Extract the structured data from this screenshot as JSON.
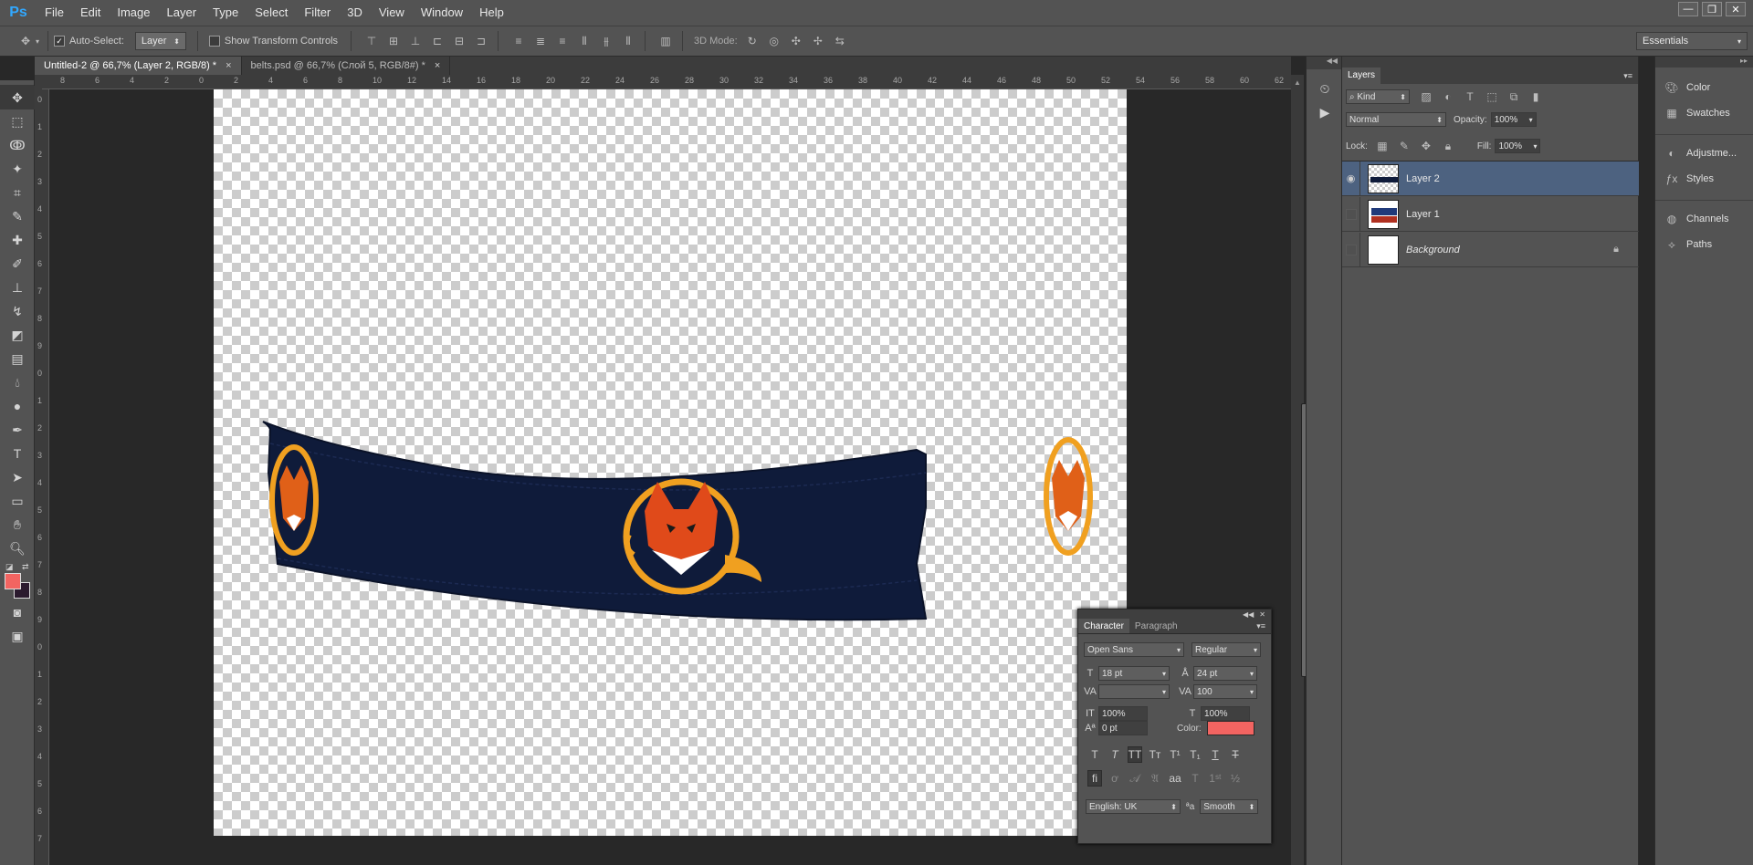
{
  "app": {
    "logo": "Ps"
  },
  "menu": [
    "File",
    "Edit",
    "Image",
    "Layer",
    "Type",
    "Select",
    "Filter",
    "3D",
    "View",
    "Window",
    "Help"
  ],
  "window_controls": [
    "—",
    "❐",
    "✕"
  ],
  "options": {
    "auto_select_label": "Auto-Select:",
    "auto_select_value": "Layer",
    "show_transform_label": "Show Transform Controls",
    "mode3d_label": "3D Mode:",
    "workspace": "Essentials"
  },
  "tabs": [
    {
      "label": "Untitled-2 @ 66,7% (Layer 2, RGB/8) *",
      "close": "×"
    },
    {
      "label": "belts.psd @ 66,7% (Слой 5, RGB/8#) *",
      "close": "×"
    }
  ],
  "ruler": {
    "h": [
      "8",
      "6",
      "4",
      "2",
      "0",
      "2",
      "4",
      "6",
      "8",
      "10",
      "12",
      "14",
      "16",
      "18",
      "20",
      "22",
      "24",
      "26",
      "28",
      "30",
      "32",
      "34",
      "36",
      "38",
      "40",
      "42",
      "44",
      "46",
      "48",
      "50",
      "52",
      "54",
      "56",
      "58",
      "60",
      "62"
    ],
    "v": [
      "0",
      "1",
      "2",
      "3",
      "4",
      "5",
      "6",
      "7",
      "8",
      "9",
      "0",
      "1",
      "2",
      "3",
      "4",
      "5",
      "6",
      "7",
      "8",
      "9",
      "0",
      "1",
      "2",
      "3",
      "4",
      "5",
      "6",
      "7"
    ]
  },
  "character": {
    "tabs": [
      "Character",
      "Paragraph"
    ],
    "font_family": "Open Sans",
    "font_style": "Regular",
    "size": "18 pt",
    "leading": "24 pt",
    "kerning": "",
    "tracking": "100",
    "vscale": "100%",
    "hscale": "100%",
    "baseline": "0 pt",
    "color_label": "Color:",
    "color_hex": "#f26461",
    "language": "English: UK",
    "aa_label": "ªa",
    "antialias": "Smooth"
  },
  "layers": {
    "tab": "Layers",
    "filter": "Kind",
    "blend": "Normal",
    "opacity_label": "Opacity:",
    "opacity": "100%",
    "lock_label": "Lock:",
    "fill_label": "Fill:",
    "fill": "100%",
    "items": [
      {
        "name": "Layer 2",
        "visible": true,
        "selected": true
      },
      {
        "name": "Layer 1",
        "visible": false,
        "selected": false
      },
      {
        "name": "Background",
        "visible": false,
        "selected": false
      }
    ]
  },
  "dock": {
    "items": [
      "Color",
      "Swatches",
      "Adjustme...",
      "Styles",
      "Channels",
      "Paths"
    ]
  },
  "colors": {
    "foreground": "#f26461",
    "background": "#2b1a2e",
    "belt": "#0f1b3a",
    "selection": "#4d6280"
  }
}
